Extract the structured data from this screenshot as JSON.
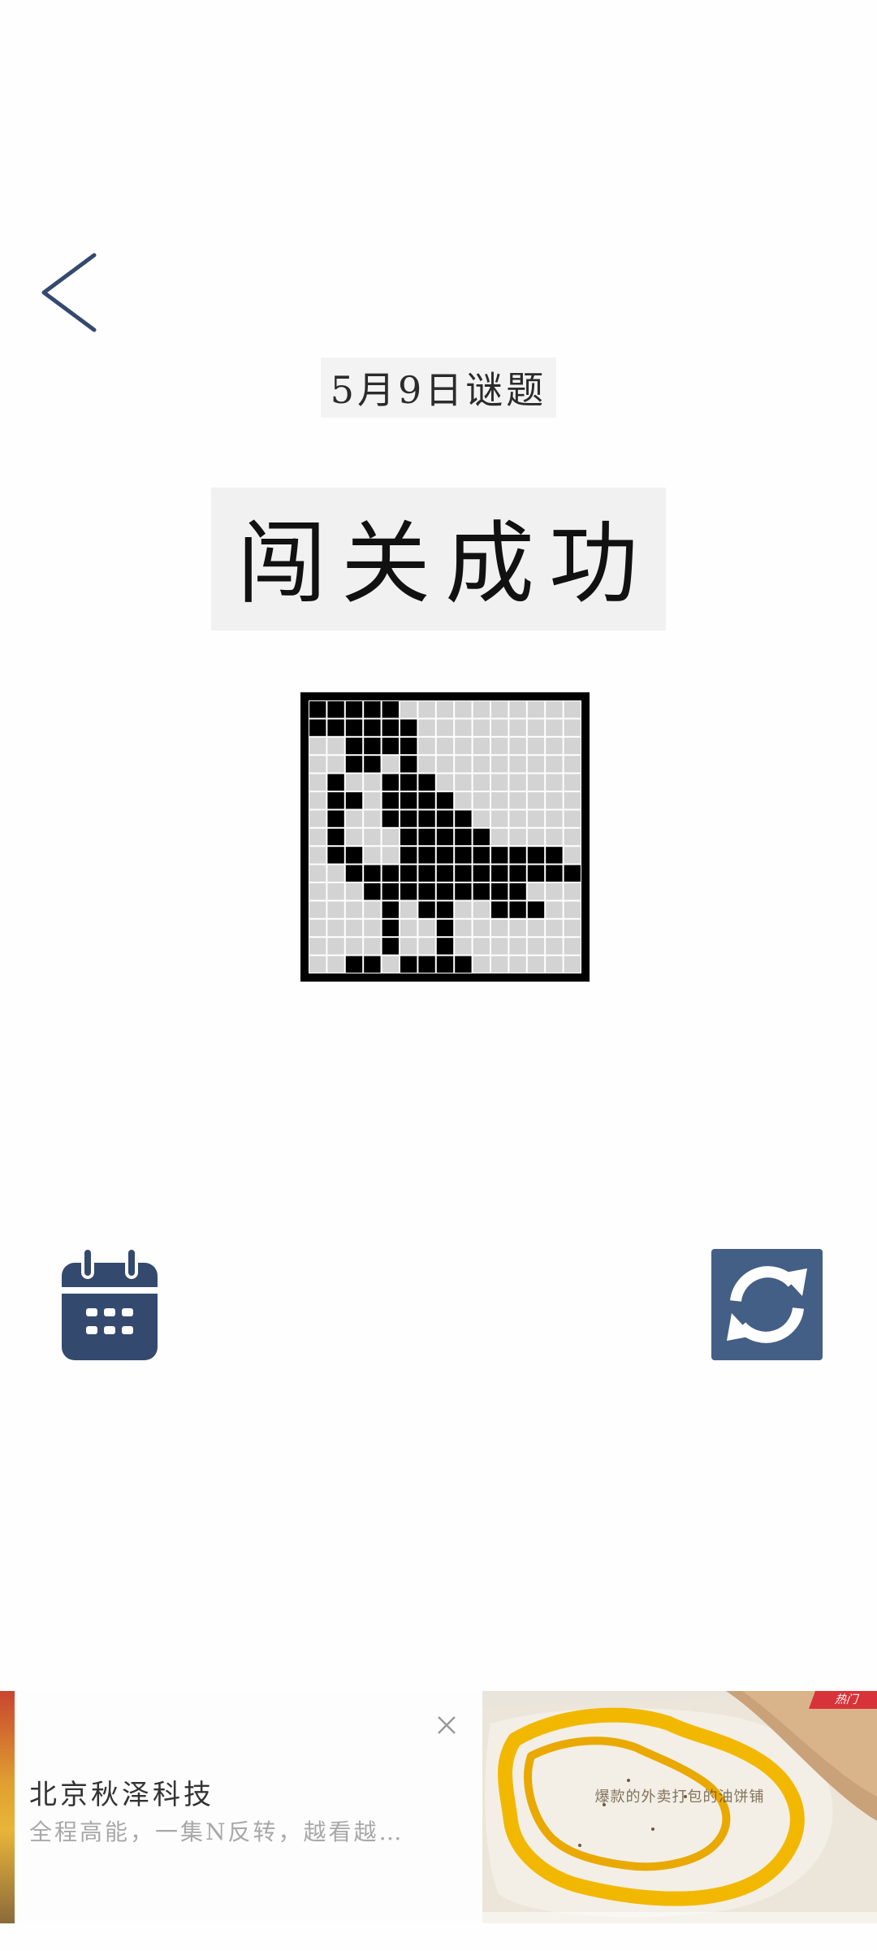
{
  "header": {
    "back_icon": "chevron-left-icon",
    "date_title": "5月9日谜题",
    "result_text": "闯关成功"
  },
  "puzzle": {
    "rows": 15,
    "cols": 15,
    "filled_color": "#000000",
    "empty_color": "#d3d3d3",
    "grid_line_color": "#ffffff",
    "filled": [
      [
        0,
        1,
        2,
        3,
        4
      ],
      [
        0,
        1,
        2,
        3,
        4,
        5
      ],
      [
        2,
        3,
        4,
        5
      ],
      [
        2,
        3,
        5
      ],
      [
        1,
        4,
        5,
        6
      ],
      [
        1,
        2,
        4,
        5,
        6,
        7
      ],
      [
        1,
        4,
        5,
        6,
        7,
        8
      ],
      [
        1,
        5,
        6,
        7,
        8,
        9
      ],
      [
        1,
        2,
        5,
        6,
        7,
        8,
        9,
        10,
        11,
        12,
        13
      ],
      [
        2,
        3,
        4,
        5,
        6,
        7,
        8,
        9,
        10,
        11,
        12,
        13,
        14
      ],
      [
        3,
        4,
        5,
        6,
        7,
        8,
        9,
        10,
        11
      ],
      [
        4,
        6,
        7,
        10,
        11,
        12
      ],
      [
        4,
        7
      ],
      [
        4,
        7
      ],
      [
        2,
        3,
        5,
        6,
        7,
        8
      ]
    ]
  },
  "actions": {
    "calendar_icon": "calendar-icon",
    "refresh_icon": "refresh-icon",
    "icon_color": "#34496e"
  },
  "ad": {
    "company": "北京秋泽科技",
    "description": "全程高能，一集N反转，越看越…",
    "close_icon": "close-icon",
    "image_caption": "爆款的外卖打包的油饼铺",
    "badge_label": "热门"
  }
}
